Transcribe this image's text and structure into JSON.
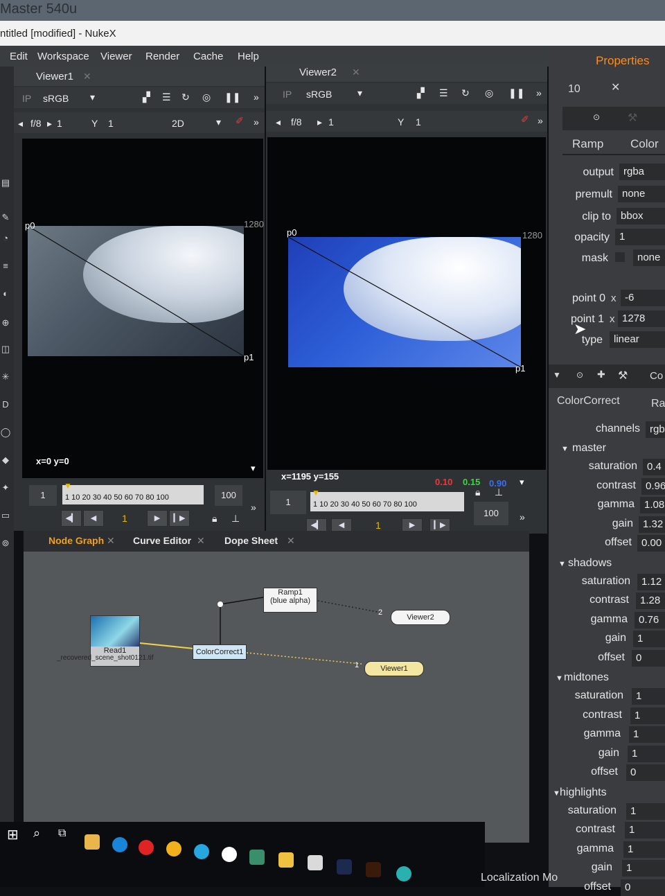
{
  "window": {
    "monitor_text": "Master 540u",
    "title": "ntitled [modified] - NukeX"
  },
  "menu": [
    "Edit",
    "Workspace",
    "Viewer",
    "Render",
    "Cache",
    "Help"
  ],
  "viewer1": {
    "tab": "Viewer1",
    "colorspace": "sRGB",
    "fstop": "f/8",
    "frame": "1",
    "y_label": "Y",
    "y_value": "1",
    "mode": "2D",
    "p0_label": "p0",
    "p1_label": "p1",
    "width_label": "1280",
    "coord": "x=0 y=0",
    "timeline": {
      "start": "1",
      "end": "100",
      "ticks": "1 10 20 30 40 50 60 70 80  100",
      "current": "1"
    }
  },
  "viewer2": {
    "tab": "Viewer2",
    "colorspace": "sRGB",
    "fstop": "f/8",
    "frame": "1",
    "y_label": "Y",
    "y_value": "1",
    "p0_label": "p0",
    "p1_label": "p1",
    "width_label": "1280",
    "coord": "x=1195 y=155",
    "r": "0.10",
    "g": "0.15",
    "b": "0.90",
    "timeline": {
      "start": "1",
      "end": "100",
      "ticks": "1 10 20 30 40 50 60 70 80  100",
      "current": "1"
    },
    "accent": "#2d5fd8"
  },
  "nodegraph": {
    "tabs": [
      "Node Graph",
      "Curve Editor",
      "Dope Sheet"
    ],
    "nodes": {
      "read": {
        "title": "Read1",
        "caption": "_recovered_scene_shot0121.tif"
      },
      "colorcorrect": {
        "title": "ColorCorrect1"
      },
      "ramp": {
        "title": "Ramp1",
        "sub": "(blue alpha)"
      },
      "viewer2": {
        "title": "Viewer2",
        "input": "2"
      },
      "viewer1": {
        "title": "Viewer1",
        "input": "1"
      }
    }
  },
  "properties": {
    "title": "Properties",
    "max_panels": "10",
    "ramp": {
      "tabs": [
        "Ramp",
        "Color"
      ],
      "fields": [
        {
          "label": "output",
          "value": "rgba"
        },
        {
          "label": "premult",
          "value": "none"
        },
        {
          "label": "clip to",
          "value": "bbox"
        },
        {
          "label": "opacity",
          "value": "1"
        },
        {
          "label": "mask",
          "value": "none"
        }
      ],
      "points": [
        {
          "label": "point 0",
          "axis": "x",
          "value": "-6"
        },
        {
          "label": "point 1",
          "axis": "x",
          "value": "1278"
        }
      ],
      "type_label": "type",
      "type_value": "linear"
    },
    "colorcorrect": {
      "tabs": [
        "ColorCorrect",
        "Ra"
      ],
      "tab_right": "Co",
      "channels_label": "channels",
      "channels_value": "rgb",
      "sections": [
        {
          "name": "master",
          "rows": [
            {
              "label": "saturation",
              "value": "0.4"
            },
            {
              "label": "contrast",
              "value": "0.96"
            },
            {
              "label": "gamma",
              "value": "1.08"
            },
            {
              "label": "gain",
              "value": "1.32"
            },
            {
              "label": "offset",
              "value": "0.00"
            }
          ]
        },
        {
          "name": "shadows",
          "rows": [
            {
              "label": "saturation",
              "value": "1.12"
            },
            {
              "label": "contrast",
              "value": "1.28"
            },
            {
              "label": "gamma",
              "value": "0.76"
            },
            {
              "label": "gain",
              "value": "1"
            },
            {
              "label": "offset",
              "value": "0"
            }
          ]
        },
        {
          "name": "midtones",
          "rows": [
            {
              "label": "saturation",
              "value": "1"
            },
            {
              "label": "contrast",
              "value": "1"
            },
            {
              "label": "gamma",
              "value": "1"
            },
            {
              "label": "gain",
              "value": "1"
            },
            {
              "label": "offset",
              "value": "0"
            }
          ]
        },
        {
          "name": "highlights",
          "rows": [
            {
              "label": "saturation",
              "value": "1"
            },
            {
              "label": "contrast",
              "value": "1"
            },
            {
              "label": "gamma",
              "value": "1"
            },
            {
              "label": "gain",
              "value": "1"
            },
            {
              "label": "offset",
              "value": "0"
            }
          ]
        }
      ]
    }
  },
  "taskbar": {
    "tray_text": "Localization Mo"
  },
  "colors": {
    "node_graph_tab": "#f0a020",
    "red": "#ff3030",
    "green": "#30e030",
    "blue": "#3a6cff",
    "accent_orange": "#ff8c1a"
  }
}
